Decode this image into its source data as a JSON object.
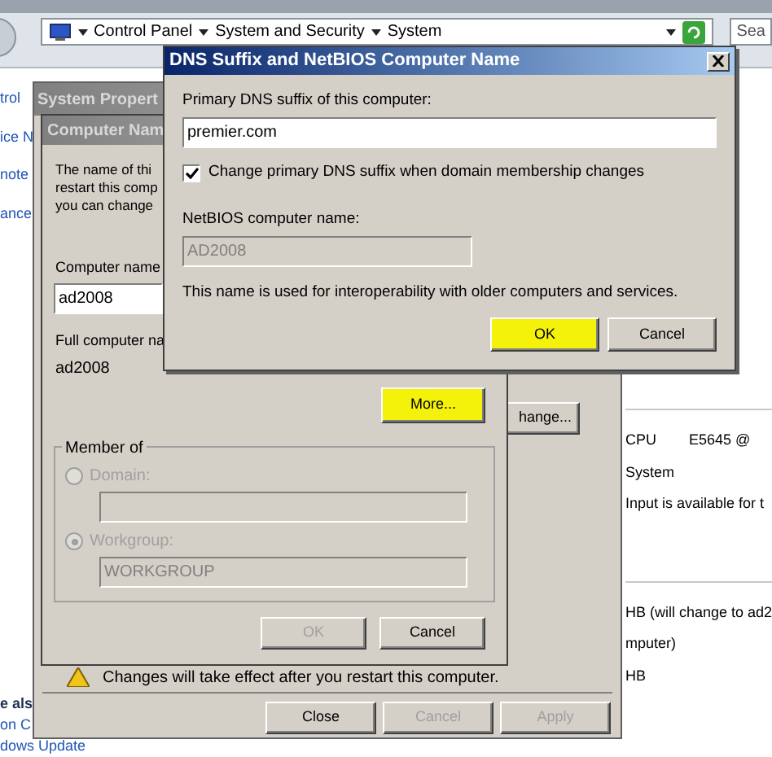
{
  "control_panel": {
    "breadcrumbs": [
      "Control Panel",
      "System and Security",
      "System"
    ],
    "search": {
      "placeholder": "Sea"
    },
    "nav_links": [
      "trol",
      "ice N",
      "note",
      "ance"
    ],
    "see_also": {
      "heading": "e als",
      "links": [
        "on C",
        "dows Update"
      ]
    },
    "detail_sections": [
      {
        "rows": [
          [
            "CPU",
            "E5645 @"
          ],
          [
            "System"
          ],
          [
            "Input is available for t"
          ]
        ]
      },
      {
        "rows": [
          [
            "HB (will change to ad2"
          ],
          [
            "mputer)"
          ],
          [
            "HB"
          ]
        ]
      }
    ]
  },
  "system_properties": {
    "title": "System Propert",
    "change_button": {
      "label": "hange..."
    },
    "warning": "Changes will take effect after you restart this computer.",
    "buttons": [
      {
        "label": "Close",
        "disabled": false
      },
      {
        "label": "Cancel",
        "disabled": true
      },
      {
        "label": "Apply",
        "disabled": true
      }
    ]
  },
  "computer_name_dialog": {
    "title": "Computer Nam",
    "intro_lines": [
      "The name of thi",
      "restart this comp",
      "you can change"
    ],
    "computer_name": {
      "label": "Computer name",
      "value": "ad2008"
    },
    "full_name": {
      "label": "Full computer na",
      "value": "ad2008"
    },
    "more_button": {
      "label": "More...",
      "highlighted": true
    },
    "member_of": {
      "title": "Member of",
      "options": [
        {
          "label": "Domain:",
          "selected": false,
          "disabled": true
        },
        {
          "label": "Workgroup:",
          "selected": true,
          "disabled": true,
          "value": "WORKGROUP"
        }
      ]
    },
    "buttons": [
      {
        "label": "OK",
        "disabled": true
      },
      {
        "label": "Cancel",
        "disabled": false
      }
    ]
  },
  "dns_dialog": {
    "title": "DNS Suffix and NetBIOS Computer Name",
    "suffix": {
      "label": "Primary DNS suffix of this computer:",
      "value": "premier.com"
    },
    "change_suffix": {
      "label": "Change primary DNS suffix when domain membership changes",
      "checked": true
    },
    "netbios": {
      "label": "NetBIOS computer name:",
      "value": "AD2008",
      "disabled": true
    },
    "note": "This name is used for interoperability with older computers and services.",
    "buttons": [
      {
        "label": "OK",
        "highlighted": true
      },
      {
        "label": "Cancel",
        "highlighted": false
      }
    ]
  }
}
